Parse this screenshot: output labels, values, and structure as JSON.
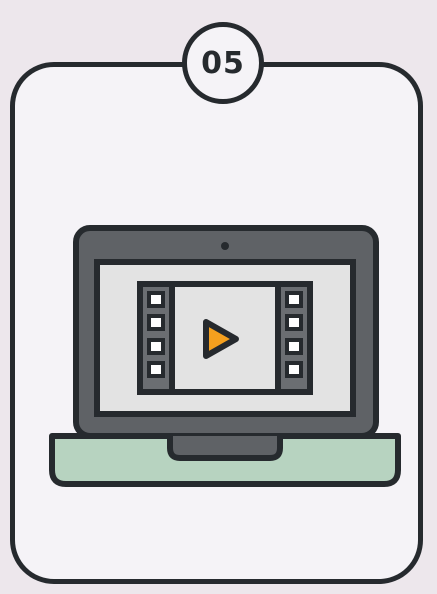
{
  "step": {
    "number": "05"
  },
  "illustration": {
    "icon": "laptop-video-player-icon",
    "colors": {
      "outline": "#262a2e",
      "bezel": "#5f6266",
      "screen": "#e3e3e3",
      "film_frame": "#6b6e72",
      "film_hole": "#ffffff",
      "play_triangle": "#f5a01e",
      "base": "#b7d3c0",
      "card_background": "#f5f3f7",
      "page_background": "#ede7ec"
    }
  }
}
